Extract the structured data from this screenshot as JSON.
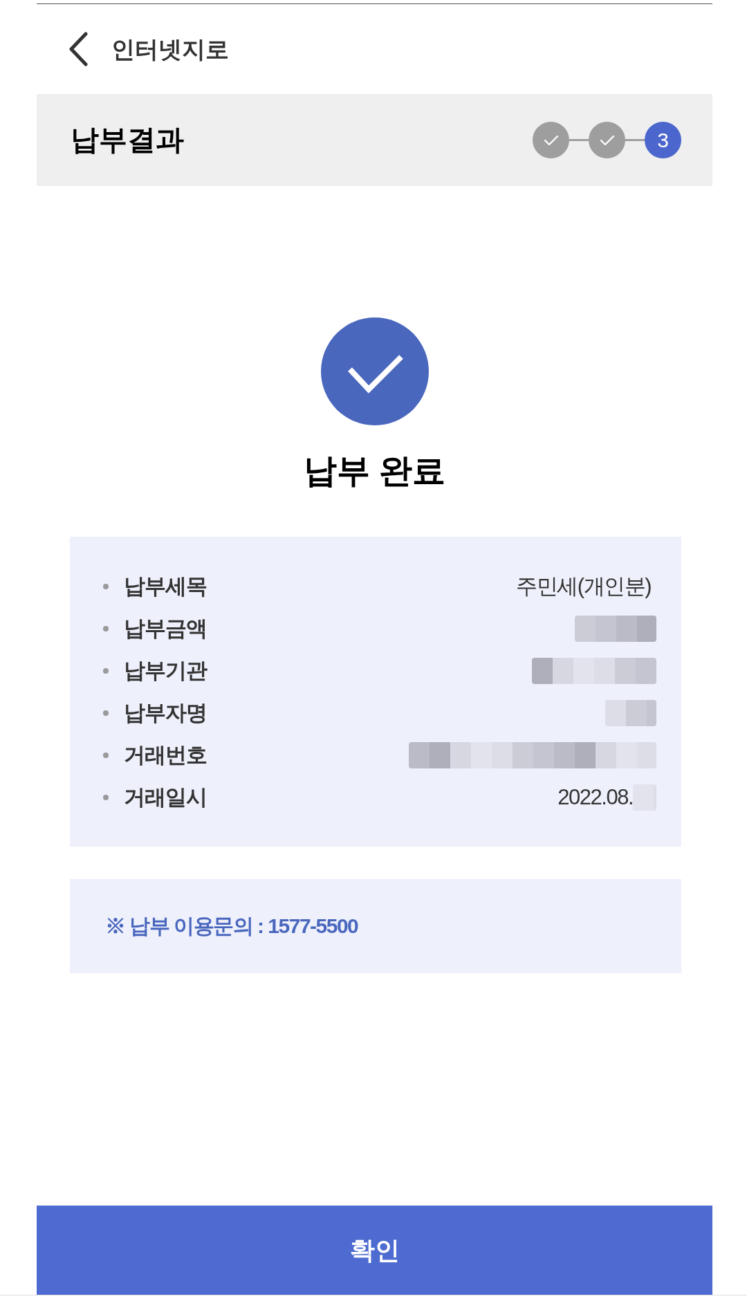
{
  "top_bar": {
    "title": "인터넷지로"
  },
  "section": {
    "title": "납부결과",
    "steps": [
      {
        "completed": true
      },
      {
        "completed": true
      },
      {
        "completed": false,
        "number": "3"
      }
    ]
  },
  "result": {
    "title": "납부 완료"
  },
  "details": [
    {
      "label": "납부세목",
      "value": "주민세(개인분)",
      "redacted": false
    },
    {
      "label": "납부금액",
      "redacted": true
    },
    {
      "label": "납부기관",
      "redacted": true
    },
    {
      "label": "납부자명",
      "redacted": true
    },
    {
      "label": "거래번호",
      "redacted": true
    },
    {
      "label": "거래일시",
      "value": "2022.08.",
      "redacted": true
    }
  ],
  "notice": {
    "text": "※ 납부 이용문의 : 1577-5500"
  },
  "confirm_button": {
    "label": "확인"
  }
}
